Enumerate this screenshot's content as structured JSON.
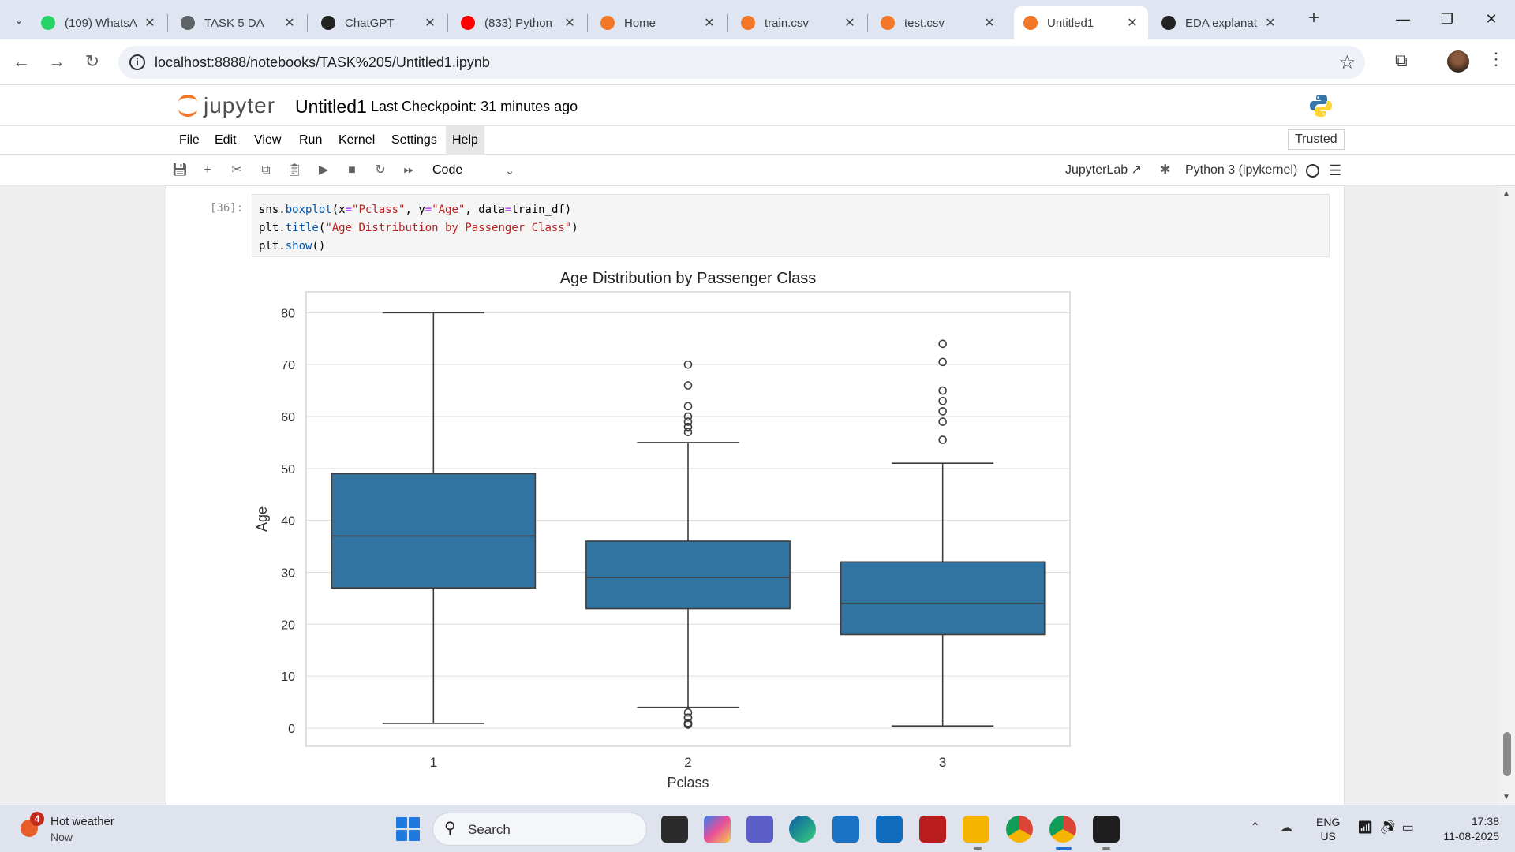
{
  "browser": {
    "tabs": [
      {
        "title": "(109) WhatsA",
        "icon": "whatsapp-icon",
        "color": "#25d366",
        "active": false
      },
      {
        "title": "TASK 5 DA",
        "icon": "globe-icon",
        "color": "#5f6368",
        "active": false
      },
      {
        "title": "ChatGPT",
        "icon": "chatgpt-icon",
        "color": "#222222",
        "active": false
      },
      {
        "title": "(833) Python",
        "icon": "youtube-icon",
        "color": "#ff0000",
        "active": false
      },
      {
        "title": "Home",
        "icon": "jupyter-loading-icon",
        "color": "#f37726",
        "active": false
      },
      {
        "title": "train.csv",
        "icon": "file-icon",
        "color": "#f37726",
        "active": false
      },
      {
        "title": "test.csv",
        "icon": "file-icon",
        "color": "#f37726",
        "active": false
      },
      {
        "title": "Untitled1",
        "icon": "notebook-icon",
        "color": "#f37726",
        "active": true
      },
      {
        "title": "EDA explanat",
        "icon": "chatgpt-icon",
        "color": "#222222",
        "active": false
      }
    ],
    "url": "localhost:8888/notebooks/TASK%205/Untitled1.ipynb"
  },
  "jupyter": {
    "logo_text": "jupyter",
    "notebook_title": "Untitled1",
    "checkpoint": "Last Checkpoint: 31 minutes ago",
    "menu": [
      "File",
      "Edit",
      "View",
      "Run",
      "Kernel",
      "Settings",
      "Help"
    ],
    "trusted": "Trusted",
    "cell_type": "Code",
    "jupyterlab_link": "JupyterLab",
    "kernel_name": "Python 3 (ipykernel)"
  },
  "cell": {
    "prompt": "[36]:",
    "code_lines": [
      "sns.boxplot(x=\"Pclass\", y=\"Age\", data=train_df)",
      "plt.title(\"Age Distribution by Passenger Class\")",
      "plt.show()"
    ]
  },
  "chart_data": {
    "type": "boxplot",
    "title": "Age Distribution by Passenger Class",
    "xlabel": "Pclass",
    "ylabel": "Age",
    "categories": [
      "1",
      "2",
      "3"
    ],
    "ylim": [
      -3.5,
      84
    ],
    "yticks": [
      0,
      10,
      20,
      30,
      40,
      50,
      60,
      70,
      80
    ],
    "grid": true,
    "box_color": "#3274a1",
    "boxes": [
      {
        "category": "1",
        "whisker_low": 0.92,
        "q1": 27,
        "median": 37,
        "q3": 49,
        "whisker_high": 80,
        "outliers": []
      },
      {
        "category": "2",
        "whisker_low": 4,
        "q1": 23,
        "median": 29,
        "q3": 36,
        "whisker_high": 55,
        "outliers": [
          0.67,
          0.83,
          0.83,
          1,
          2,
          2,
          3,
          57,
          58,
          59,
          60,
          62,
          66,
          70
        ]
      },
      {
        "category": "3",
        "whisker_low": 0.42,
        "q1": 18,
        "median": 24,
        "q3": 32,
        "whisker_high": 51,
        "outliers": [
          55.5,
          59,
          61,
          63,
          65,
          70.5,
          74
        ]
      }
    ]
  },
  "taskbar": {
    "weather_badge": "4",
    "weather_title": "Hot weather",
    "weather_sub": "Now",
    "search_label": "Search",
    "lang_line1": "ENG",
    "lang_line2": "US",
    "time": "17:38",
    "date": "11-08-2025"
  }
}
